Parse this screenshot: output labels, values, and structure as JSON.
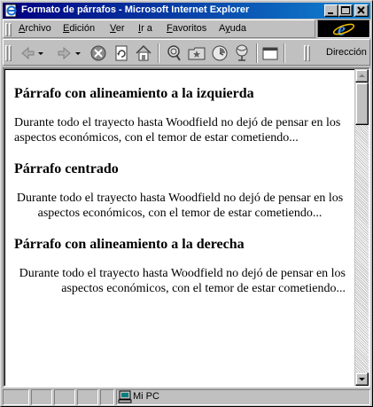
{
  "window": {
    "title": "Formato de párrafos - Microsoft Internet Explorer",
    "title_bar_color": "#000080"
  },
  "title_buttons": {
    "minimize": "minimize-icon",
    "maximize": "maximize-icon",
    "close": "close-icon"
  },
  "menu": {
    "items": [
      {
        "label": "Archivo",
        "mnemonic": "A"
      },
      {
        "label": "Edición",
        "mnemonic": "E"
      },
      {
        "label": "Ver",
        "mnemonic": "V"
      },
      {
        "label": "Ir a",
        "mnemonic": "I"
      },
      {
        "label": "Favoritos",
        "mnemonic": "F"
      },
      {
        "label": "Ayuda",
        "mnemonic": "y"
      }
    ]
  },
  "toolbar": {
    "buttons": [
      "back-icon",
      "forward-icon",
      "stop-icon",
      "refresh-icon",
      "home-icon",
      "search-icon",
      "favorites-icon",
      "history-icon",
      "channels-icon",
      "fullscreen-icon"
    ],
    "address_label": "Dirección"
  },
  "content": {
    "sections": [
      {
        "heading": "Párrafo con alineamiento a la izquierda",
        "paragraph": "Durante todo el trayecto hasta Woodfield no dejó de pensar en los aspectos económicos, con el temor de estar cometiendo...",
        "align": "left"
      },
      {
        "heading": "Párrafo centrado",
        "paragraph": "Durante todo el trayecto hasta Woodfield no dejó de pensar en los aspectos económicos, con el temor de estar cometiendo...",
        "align": "center"
      },
      {
        "heading": "Párrafo con alineamiento a la derecha",
        "paragraph": "Durante todo el trayecto hasta Woodfield no dejó de pensar en los aspectos económicos, con el temor de estar cometiendo...",
        "align": "right"
      }
    ]
  },
  "statusbar": {
    "zone": "Mi PC",
    "zone_icon": "computer-icon"
  },
  "colors": {
    "chrome": "#c0c0c0",
    "content_bg": "#ffffff"
  }
}
